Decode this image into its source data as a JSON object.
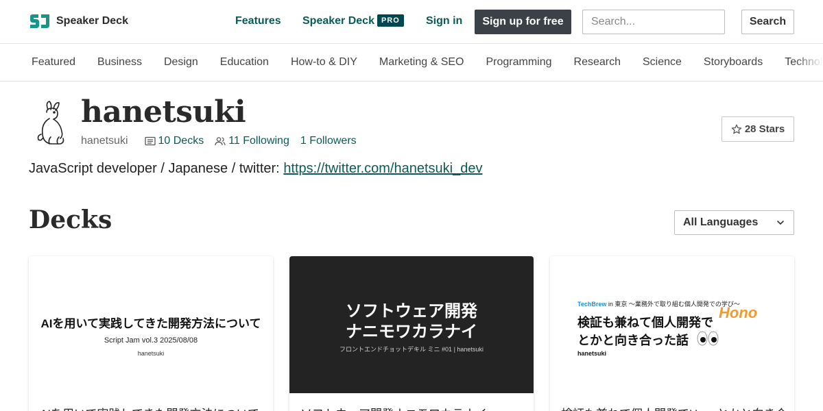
{
  "header": {
    "brand": "Speaker Deck",
    "nav": {
      "features": "Features",
      "pro_label": "Speaker Deck",
      "pro_badge": "PRO",
      "signin": "Sign in",
      "signup": "Sign up for free"
    },
    "search": {
      "placeholder": "Search...",
      "button": "Search"
    }
  },
  "categories": [
    "Featured",
    "Business",
    "Design",
    "Education",
    "How-to & DIY",
    "Marketing & SEO",
    "Programming",
    "Research",
    "Science",
    "Storyboards",
    "Technology"
  ],
  "profile": {
    "name": "hanetsuki",
    "handle": "hanetsuki",
    "decks": "10 Decks",
    "following": "11 Following",
    "followers": "1 Followers",
    "stars": "28 Stars",
    "bio_text": "JavaScript developer / Japanese / twitter: ",
    "bio_link": "https://twitter.com/hanetsuki_dev"
  },
  "decks_section": {
    "title": "Decks",
    "language_filter": "All Languages"
  },
  "decks": [
    {
      "title": "AIを用いて実践してきた開発方法について",
      "thumb_heading": "AIを用いて実践してきた開発方法について",
      "thumb_sub1": "Script Jam vol.3 2025/08/08",
      "thumb_sub2": "hanetsuki"
    },
    {
      "title": "ソフトウェア開発ナニモワカラナイ",
      "thumb_line1": "ソフトウェア開発",
      "thumb_line2": "ナニモワカラナイ",
      "thumb_sub": "フロントエンドチョットデキル ミニ #01 | hanetsuki"
    },
    {
      "title": "検証も兼ねて個人開発でHonoとかと向き合った話",
      "thumb_top_brand": "TechBrew",
      "thumb_top_rest": " in 東京 〜業務外で取り組む個人開発での学び〜",
      "thumb_line1": "検証も兼ねて個人開発で",
      "thumb_line2": "とかと向き合った話",
      "thumb_author": "hanetsuki",
      "thumb_logo": "Hono"
    }
  ],
  "colors": {
    "accent": "#0a5a56",
    "pro_badge_bg": "#00474f",
    "signup_bg": "#3b4146",
    "hono_orange": "#f39a2a"
  }
}
